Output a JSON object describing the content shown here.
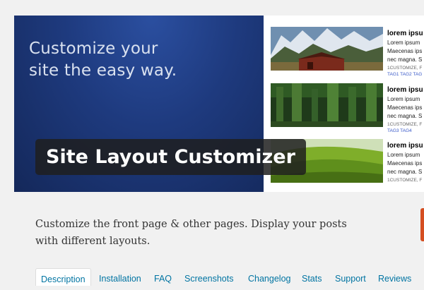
{
  "banner": {
    "tagline_line1": "Customize your",
    "tagline_line2": "site the easy way.",
    "plugin_name": "Site Layout Customizer"
  },
  "posts": [
    {
      "title": "lorem ipsu",
      "body1": "Lorem ipsum",
      "body2": "Maecenas ips",
      "body3": "nec magna. S",
      "meta": "1CUSTOMIZE, F",
      "tags": "TAG1 TAG2 TAG"
    },
    {
      "title": "lorem ipsu",
      "body1": "Lorem ipsum",
      "body2": "Maecenas ips",
      "body3": "nec magna. S",
      "meta": "1CUSTOMIZE, F",
      "tags": "TAG3 TAG4"
    },
    {
      "title": "lorem ipsu",
      "body1": "Lorem ipsum",
      "body2": "Maecenas ips",
      "body3": "nec magna. S",
      "meta": "1CUSTOMIZE, F",
      "tags": ""
    }
  ],
  "description": "Customize the front page & other pages. Display your posts with different layouts.",
  "tabs": [
    "Description",
    "Installation",
    "FAQ",
    "Screenshots",
    "Changelog",
    "Stats",
    "Support",
    "Reviews"
  ],
  "active_tab": "Description",
  "colors": {
    "banner_blue": "#1e3a7e",
    "link": "#0074a2",
    "accent_orange": "#d54e21"
  }
}
